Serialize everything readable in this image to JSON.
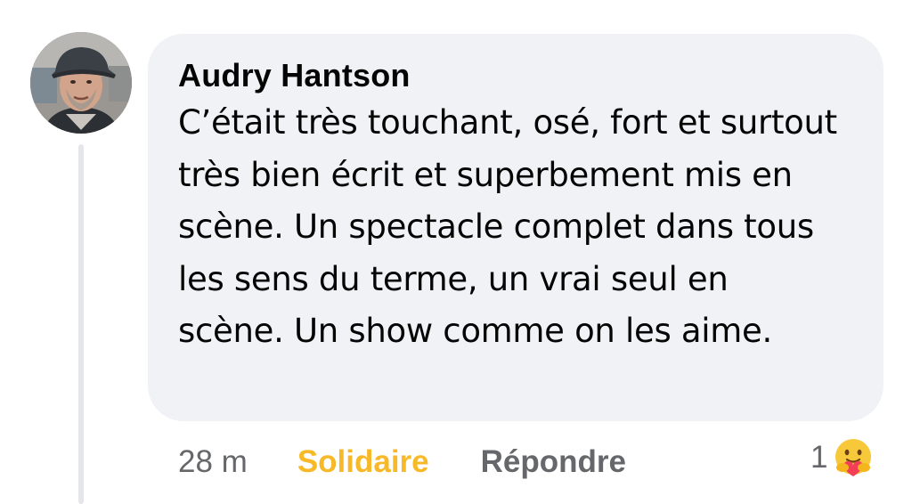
{
  "comment": {
    "author": "Audry Hantson",
    "text": "C’était très touchant, osé, fort et surtout très bien écrit et superbement mis en scène. Un spectacle complet dans tous les sens du terme, un vrai seul en scène. Un show comme on les aime.",
    "timestamp": "28 m",
    "user_reaction_label": "Solidaire",
    "reply_label": "Répondre",
    "reaction_count": "1",
    "reaction_icon": "care-hug-emoji-icon"
  },
  "colors": {
    "bubble": "#f0f2f5",
    "reaction_active": "#f7b928",
    "secondary_text": "#65676b",
    "primary_text": "#050505"
  }
}
